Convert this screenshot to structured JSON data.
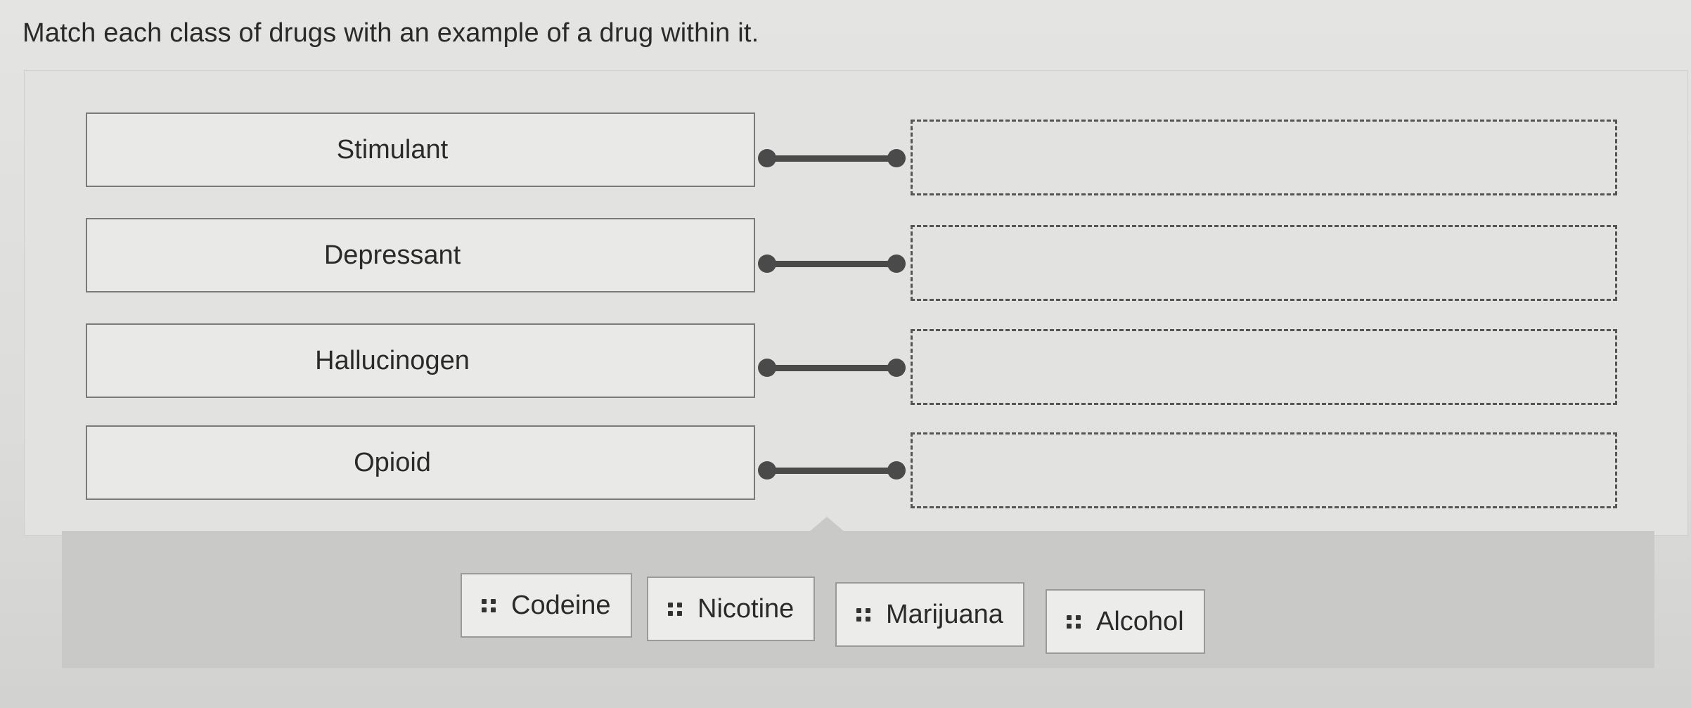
{
  "question": {
    "prompt": "Match each class of drugs with an example of a drug within it."
  },
  "classes": [
    {
      "label": "Stimulant"
    },
    {
      "label": "Depressant"
    },
    {
      "label": "Hallucinogen"
    },
    {
      "label": "Opioid"
    }
  ],
  "answer_slots": [
    {
      "value": ""
    },
    {
      "value": ""
    },
    {
      "value": ""
    },
    {
      "value": ""
    }
  ],
  "choices": [
    {
      "label": "Codeine",
      "icon": "drag-handle-icon"
    },
    {
      "label": "Nicotine",
      "icon": "drag-handle-icon"
    },
    {
      "label": "Marijuana",
      "icon": "drag-handle-icon"
    },
    {
      "label": "Alcohol",
      "icon": "drag-handle-icon"
    }
  ]
}
